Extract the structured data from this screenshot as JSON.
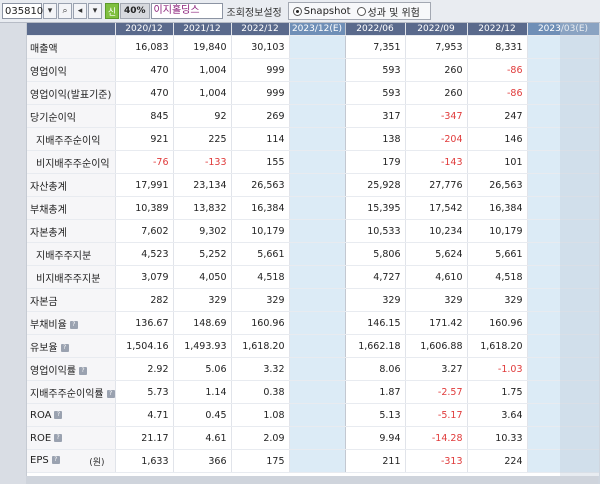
{
  "toolbar": {
    "code": "035810",
    "sin_label": "신",
    "pct_label": "40%",
    "company_name": "이지홀딩스",
    "settings_label": "조회정보설정",
    "radio_snapshot": "Snapshot",
    "radio_performance": "성과 및 위험"
  },
  "table": {
    "headers": [
      "2020/12",
      "2021/12",
      "2022/12",
      "2023/12(E)",
      "2022/06",
      "2022/09",
      "2022/12",
      "2023/03(E)"
    ],
    "rows": [
      {
        "label": "매출액",
        "sub": false,
        "info": false,
        "values": [
          "16,083",
          "19,840",
          "30,103",
          "",
          "7,351",
          "7,953",
          "8,331",
          ""
        ]
      },
      {
        "label": "영업이익",
        "sub": false,
        "info": false,
        "values": [
          "470",
          "1,004",
          "999",
          "",
          "593",
          "260",
          "-86",
          ""
        ]
      },
      {
        "label": "영업이익(발표기준)",
        "sub": false,
        "info": false,
        "values": [
          "470",
          "1,004",
          "999",
          "",
          "593",
          "260",
          "-86",
          ""
        ]
      },
      {
        "label": "당기순이익",
        "sub": false,
        "info": false,
        "values": [
          "845",
          "92",
          "269",
          "",
          "317",
          "-347",
          "247",
          ""
        ]
      },
      {
        "label": "지배주주순이익",
        "sub": true,
        "info": false,
        "values": [
          "921",
          "225",
          "114",
          "",
          "138",
          "-204",
          "146",
          ""
        ]
      },
      {
        "label": "비지배주주순이익",
        "sub": true,
        "info": false,
        "values": [
          "-76",
          "-133",
          "155",
          "",
          "179",
          "-143",
          "101",
          ""
        ]
      },
      {
        "label": "자산총계",
        "sub": false,
        "info": false,
        "values": [
          "17,991",
          "23,134",
          "26,563",
          "",
          "25,928",
          "27,776",
          "26,563",
          ""
        ]
      },
      {
        "label": "부채총계",
        "sub": false,
        "info": false,
        "values": [
          "10,389",
          "13,832",
          "16,384",
          "",
          "15,395",
          "17,542",
          "16,384",
          ""
        ]
      },
      {
        "label": "자본총계",
        "sub": false,
        "info": false,
        "values": [
          "7,602",
          "9,302",
          "10,179",
          "",
          "10,533",
          "10,234",
          "10,179",
          ""
        ]
      },
      {
        "label": "지배주주지분",
        "sub": true,
        "info": false,
        "values": [
          "4,523",
          "5,252",
          "5,661",
          "",
          "5,806",
          "5,624",
          "5,661",
          ""
        ]
      },
      {
        "label": "비지배주주지분",
        "sub": true,
        "info": false,
        "values": [
          "3,079",
          "4,050",
          "4,518",
          "",
          "4,727",
          "4,610",
          "4,518",
          ""
        ]
      },
      {
        "label": "자본금",
        "sub": false,
        "info": false,
        "values": [
          "282",
          "329",
          "329",
          "",
          "329",
          "329",
          "329",
          ""
        ]
      },
      {
        "label": "부채비율",
        "sub": false,
        "info": true,
        "values": [
          "136.67",
          "148.69",
          "160.96",
          "",
          "146.15",
          "171.42",
          "160.96",
          ""
        ]
      },
      {
        "label": "유보율",
        "sub": false,
        "info": true,
        "values": [
          "1,504.16",
          "1,493.93",
          "1,618.20",
          "",
          "1,662.18",
          "1,606.88",
          "1,618.20",
          ""
        ]
      },
      {
        "label": "영업이익률",
        "sub": false,
        "info": true,
        "values": [
          "2.92",
          "5.06",
          "3.32",
          "",
          "8.06",
          "3.27",
          "-1.03",
          ""
        ]
      },
      {
        "label": "지배주주순이익률",
        "sub": false,
        "info": true,
        "values": [
          "5.73",
          "1.14",
          "0.38",
          "",
          "1.87",
          "-2.57",
          "1.75",
          ""
        ]
      },
      {
        "label": "ROA",
        "sub": false,
        "info": true,
        "values": [
          "4.71",
          "0.45",
          "1.08",
          "",
          "5.13",
          "-5.17",
          "3.64",
          ""
        ]
      },
      {
        "label": "ROE",
        "sub": false,
        "info": true,
        "values": [
          "21.17",
          "4.61",
          "2.09",
          "",
          "9.94",
          "-14.28",
          "10.33",
          ""
        ]
      },
      {
        "label": "EPS",
        "sub": false,
        "info": true,
        "unit": "(원)",
        "values": [
          "1,633",
          "366",
          "175",
          "",
          "211",
          "-313",
          "224",
          ""
        ]
      }
    ]
  },
  "colors": {
    "negative": "#e03b3b",
    "header_bg": "#5a6a8c",
    "estimate_bg": "#dcebf6"
  }
}
